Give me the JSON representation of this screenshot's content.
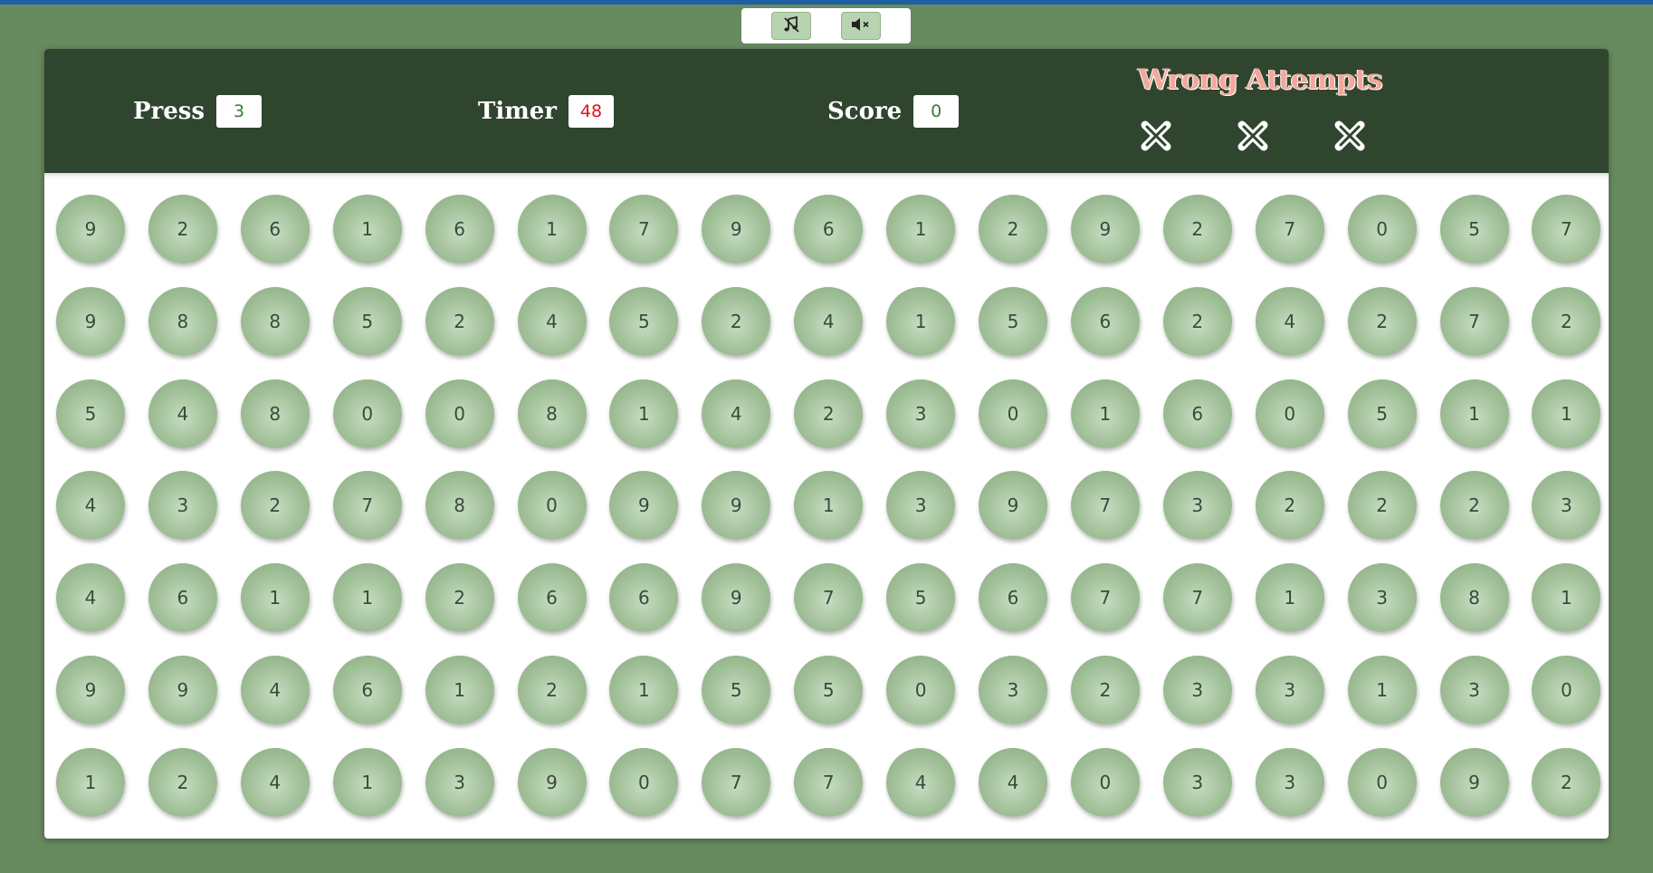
{
  "controls": {
    "music_icon": "music-off-icon",
    "mute_icon": "speaker-mute-icon"
  },
  "header": {
    "press_label": "Press",
    "press_value": "3",
    "timer_label": "Timer",
    "timer_value": "48",
    "score_label": "Score",
    "score_value": "0",
    "wrong_attempts_label": "Wrong Attempts",
    "wrong_attempts_marks": [
      "cross-icon",
      "cross-icon",
      "cross-icon"
    ]
  },
  "colors": {
    "background": "#678b5e",
    "header": "#2f452e",
    "ball": "#a6c49e",
    "timer_value": "#e0141c",
    "wrong_attempts_title": "#f2a89c"
  },
  "board": {
    "rows": [
      [
        "9",
        "2",
        "6",
        "1",
        "6",
        "1",
        "7",
        "9",
        "6",
        "1",
        "2",
        "9",
        "2",
        "7",
        "0",
        "5",
        "7"
      ],
      [
        "9",
        "8",
        "8",
        "5",
        "2",
        "4",
        "5",
        "2",
        "4",
        "1",
        "5",
        "6",
        "2",
        "4",
        "2",
        "7",
        "2"
      ],
      [
        "5",
        "4",
        "8",
        "0",
        "0",
        "8",
        "1",
        "4",
        "2",
        "3",
        "0",
        "1",
        "6",
        "0",
        "5",
        "1",
        "1"
      ],
      [
        "4",
        "3",
        "2",
        "7",
        "8",
        "0",
        "9",
        "9",
        "1",
        "3",
        "9",
        "7",
        "3",
        "2",
        "2",
        "2",
        "3"
      ],
      [
        "4",
        "6",
        "1",
        "1",
        "2",
        "6",
        "6",
        "9",
        "7",
        "5",
        "6",
        "7",
        "7",
        "1",
        "3",
        "8",
        "1"
      ],
      [
        "9",
        "9",
        "4",
        "6",
        "1",
        "2",
        "1",
        "5",
        "5",
        "0",
        "3",
        "2",
        "3",
        "3",
        "1",
        "3",
        "0"
      ],
      [
        "1",
        "2",
        "4",
        "1",
        "3",
        "9",
        "0",
        "7",
        "7",
        "4",
        "4",
        "0",
        "3",
        "3",
        "0",
        "9",
        "2"
      ]
    ]
  }
}
